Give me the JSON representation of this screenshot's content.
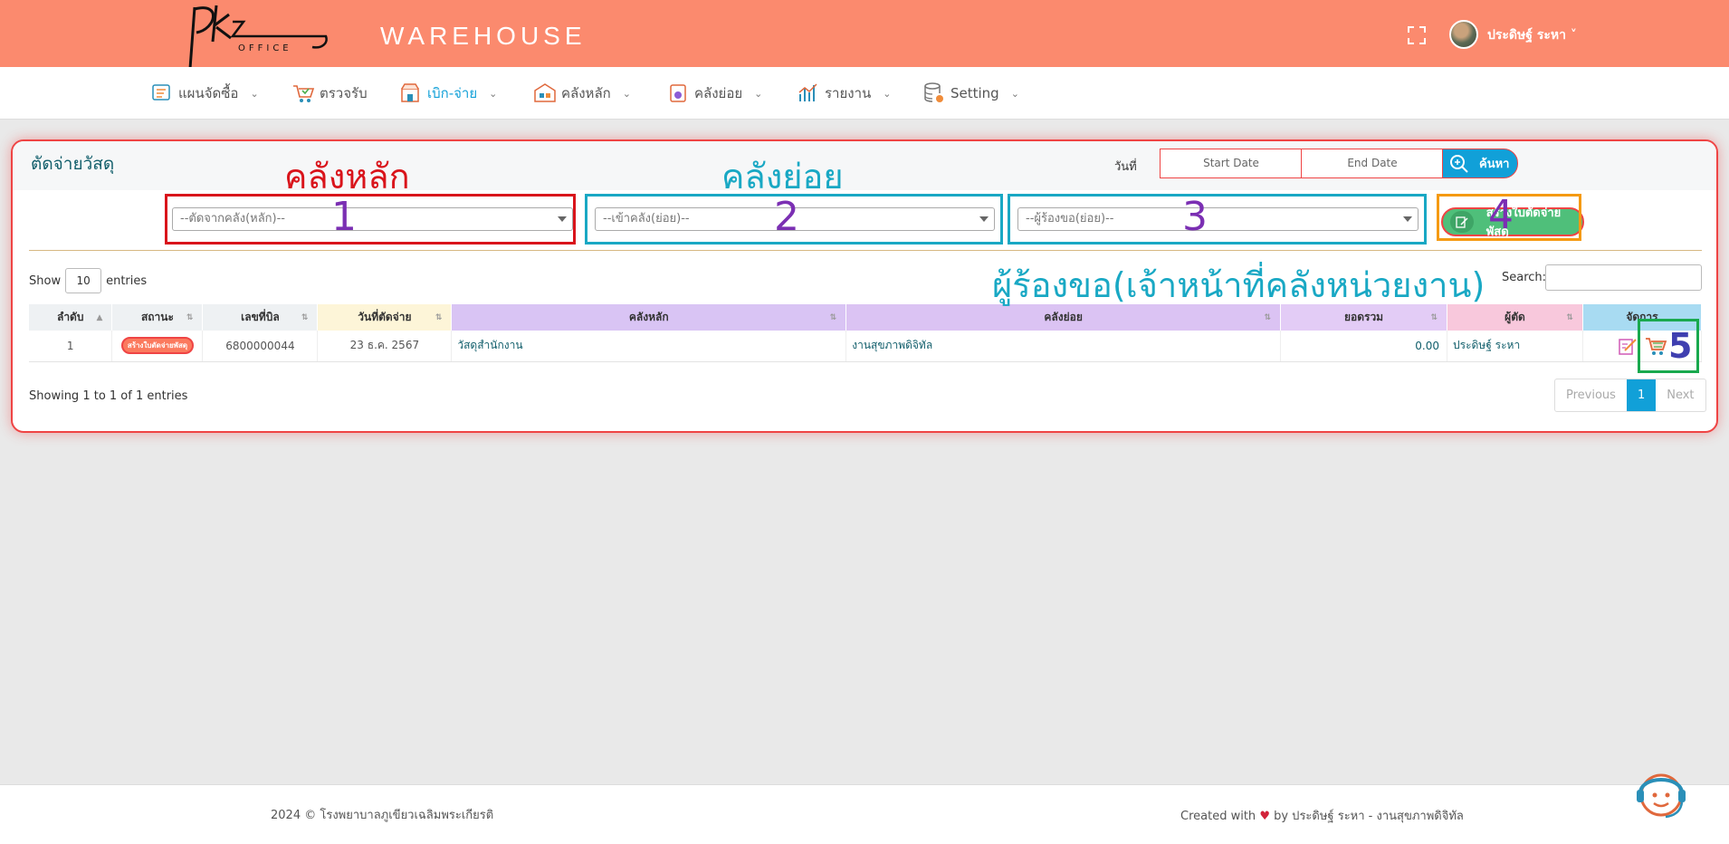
{
  "header": {
    "logo_text": "OFFICE",
    "brand": "WAREHOUSE",
    "user_name": "ประดิษฐ์ ระหา ˅"
  },
  "nav": [
    {
      "label": "แผนจัดซื้อ",
      "icon": "plan-icon",
      "dropdown": true
    },
    {
      "label": "ตรวจรับ",
      "icon": "cart-check-icon",
      "dropdown": false
    },
    {
      "label": "เบิก-จ่าย",
      "icon": "store-icon",
      "dropdown": true,
      "active": true
    },
    {
      "label": "คลังหลัก",
      "icon": "warehouse-icon",
      "dropdown": true
    },
    {
      "label": "คลังย่อย",
      "icon": "box-icon",
      "dropdown": true
    },
    {
      "label": "รายงาน",
      "icon": "chart-icon",
      "dropdown": true
    },
    {
      "label": "Setting",
      "icon": "database-gear-icon",
      "dropdown": true
    }
  ],
  "card": {
    "title": "ตัดจ่ายวัสดุ",
    "date_label": "วันที่",
    "start_date_placeholder": "Start Date",
    "end_date_placeholder": "End Date",
    "search_button": "ค้นหา",
    "select_main": "--ตัดจากคลัง(หลัก)--",
    "select_sub": "--เข้าคลัง(ย่อย)--",
    "select_requester": "--ผู้ร้องขอ(ย่อย)--",
    "create_button": "สร้างใบตัดจ่ายพัสดุ"
  },
  "annotations": {
    "label_main": "คลังหลัก",
    "label_sub": "คลังย่อย",
    "label_requester": "ผู้ร้องขอ(เจ้าหน้าที่คลังหน่วยงาน)",
    "n1": "1",
    "n2": "2",
    "n3": "3",
    "n4": "4",
    "n5": "5"
  },
  "table_controls": {
    "show": "Show",
    "entries_value": "10",
    "entries": "entries",
    "search_label": "Search:"
  },
  "table": {
    "headers": [
      "ลำดับ",
      "สถานะ",
      "เลขที่บิล",
      "วันที่ตัดจ่าย",
      "คลังหลัก",
      "คลังย่อย",
      "ยอดรวม",
      "ผู้ตัด",
      "จัดการ"
    ],
    "rows": [
      {
        "no": "1",
        "status": "สร้างใบตัดจ่ายพัสดุ",
        "bill": "6800000044",
        "date": "23 ธ.ค. 2567",
        "main_store": "วัสดุสำนักงาน",
        "sub_store": "งานสุขภาพดิจิทัล",
        "total": "0.00",
        "cutter": "ประดิษฐ์ ระหา"
      }
    ]
  },
  "pagination": {
    "info": "Showing 1 to 1 of 1 entries",
    "previous": "Previous",
    "page": "1",
    "next": "Next"
  },
  "footer": {
    "left": "2024 © โรงพยาบาลภูเขียวเฉลิมพระเกียรติ",
    "created_with": "Created with",
    "by_text": "by ประดิษฐ์ ระหา - งานสุขภาพดิจิทัล"
  },
  "colors": {
    "header_bg": "#fb8a6e",
    "accent": "#11a0d8",
    "annotation_red": "#d9141b",
    "annotation_teal": "#19a8c4",
    "annotation_purple": "#7b2fb3",
    "annotation_orange": "#f59a12",
    "annotation_green": "#19a94e"
  }
}
